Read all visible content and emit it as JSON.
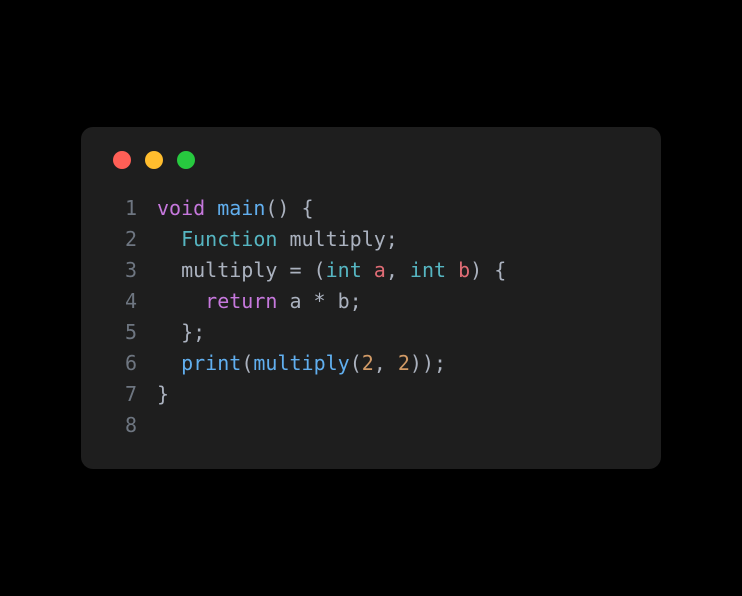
{
  "window": {
    "controls": [
      "close",
      "minimize",
      "maximize"
    ]
  },
  "code": {
    "lines": [
      {
        "number": "1",
        "tokens": [
          {
            "text": "void",
            "class": "tok-keyword"
          },
          {
            "text": " ",
            "class": "tok-punct"
          },
          {
            "text": "main",
            "class": "tok-function"
          },
          {
            "text": "() {",
            "class": "tok-punct"
          }
        ]
      },
      {
        "number": "2",
        "tokens": [
          {
            "text": "  ",
            "class": "tok-punct"
          },
          {
            "text": "Function",
            "class": "tok-class"
          },
          {
            "text": " ",
            "class": "tok-punct"
          },
          {
            "text": "multiply",
            "class": "tok-var"
          },
          {
            "text": ";",
            "class": "tok-punct"
          }
        ]
      },
      {
        "number": "3",
        "tokens": [
          {
            "text": "  ",
            "class": "tok-punct"
          },
          {
            "text": "multiply",
            "class": "tok-var"
          },
          {
            "text": " ",
            "class": "tok-punct"
          },
          {
            "text": "=",
            "class": "tok-operator"
          },
          {
            "text": " (",
            "class": "tok-punct"
          },
          {
            "text": "int",
            "class": "tok-type"
          },
          {
            "text": " ",
            "class": "tok-punct"
          },
          {
            "text": "a",
            "class": "tok-param"
          },
          {
            "text": ", ",
            "class": "tok-punct"
          },
          {
            "text": "int",
            "class": "tok-type"
          },
          {
            "text": " ",
            "class": "tok-punct"
          },
          {
            "text": "b",
            "class": "tok-param"
          },
          {
            "text": ") {",
            "class": "tok-punct"
          }
        ]
      },
      {
        "number": "4",
        "tokens": [
          {
            "text": "    ",
            "class": "tok-punct"
          },
          {
            "text": "return",
            "class": "tok-keyword"
          },
          {
            "text": " a ",
            "class": "tok-var"
          },
          {
            "text": "*",
            "class": "tok-operator"
          },
          {
            "text": " b;",
            "class": "tok-var"
          }
        ]
      },
      {
        "number": "5",
        "tokens": [
          {
            "text": "  };",
            "class": "tok-punct"
          }
        ]
      },
      {
        "number": "6",
        "tokens": [
          {
            "text": "  ",
            "class": "tok-punct"
          },
          {
            "text": "print",
            "class": "tok-function"
          },
          {
            "text": "(",
            "class": "tok-punct"
          },
          {
            "text": "multiply",
            "class": "tok-function"
          },
          {
            "text": "(",
            "class": "tok-punct"
          },
          {
            "text": "2",
            "class": "tok-number"
          },
          {
            "text": ", ",
            "class": "tok-punct"
          },
          {
            "text": "2",
            "class": "tok-number"
          },
          {
            "text": "));",
            "class": "tok-punct"
          }
        ]
      },
      {
        "number": "7",
        "tokens": [
          {
            "text": "}",
            "class": "tok-punct"
          }
        ]
      },
      {
        "number": "8",
        "tokens": []
      }
    ]
  }
}
